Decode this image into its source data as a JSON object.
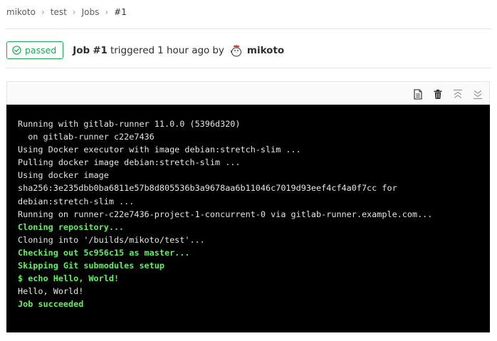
{
  "breadcrumb": {
    "items": [
      "mikoto",
      "test",
      "Jobs"
    ],
    "current": "#1"
  },
  "header": {
    "status": "passed",
    "status_color": "#1aaa55",
    "job_label": "Job",
    "job_number": "#1",
    "triggered_text": "triggered",
    "time_ago": "1 hour ago",
    "by_text": "by",
    "user_name": "mikoto",
    "avatar_icon": "chicken-avatar"
  },
  "log_controls": {
    "icons": [
      "raw-log-icon",
      "erase-log-icon",
      "scroll-top-icon",
      "scroll-bottom-icon"
    ]
  },
  "log": {
    "lines": [
      {
        "text": "Running with gitlab-runner 11.0.0 (5396d320)",
        "style": "normal"
      },
      {
        "text": "  on gitlab-runner c22e7436",
        "style": "normal"
      },
      {
        "text": "Using Docker executor with image debian:stretch-slim ...",
        "style": "normal"
      },
      {
        "text": "Pulling docker image debian:stretch-slim ...",
        "style": "normal"
      },
      {
        "text": "Using docker image",
        "style": "normal"
      },
      {
        "text": "sha256:3e235dbb0ba6811e57b8d805536b3a9678aa6b11046c7019d93eef4cf4a0f7cc for",
        "style": "normal"
      },
      {
        "text": "debian:stretch-slim ...",
        "style": "normal"
      },
      {
        "text": "Running on runner-c22e7436-project-1-concurrent-0 via gitlab-runner.example.com...",
        "style": "normal"
      },
      {
        "text": "Cloning repository...",
        "style": "green"
      },
      {
        "text": "Cloning into '/builds/mikoto/test'...",
        "style": "normal"
      },
      {
        "text": "Checking out 5c956c15 as master...",
        "style": "green"
      },
      {
        "text": "Skipping Git submodules setup",
        "style": "green"
      },
      {
        "text": "$ echo Hello, World!",
        "style": "green"
      },
      {
        "text": "Hello, World!",
        "style": "normal"
      },
      {
        "text": "Job succeeded",
        "style": "green"
      }
    ]
  }
}
